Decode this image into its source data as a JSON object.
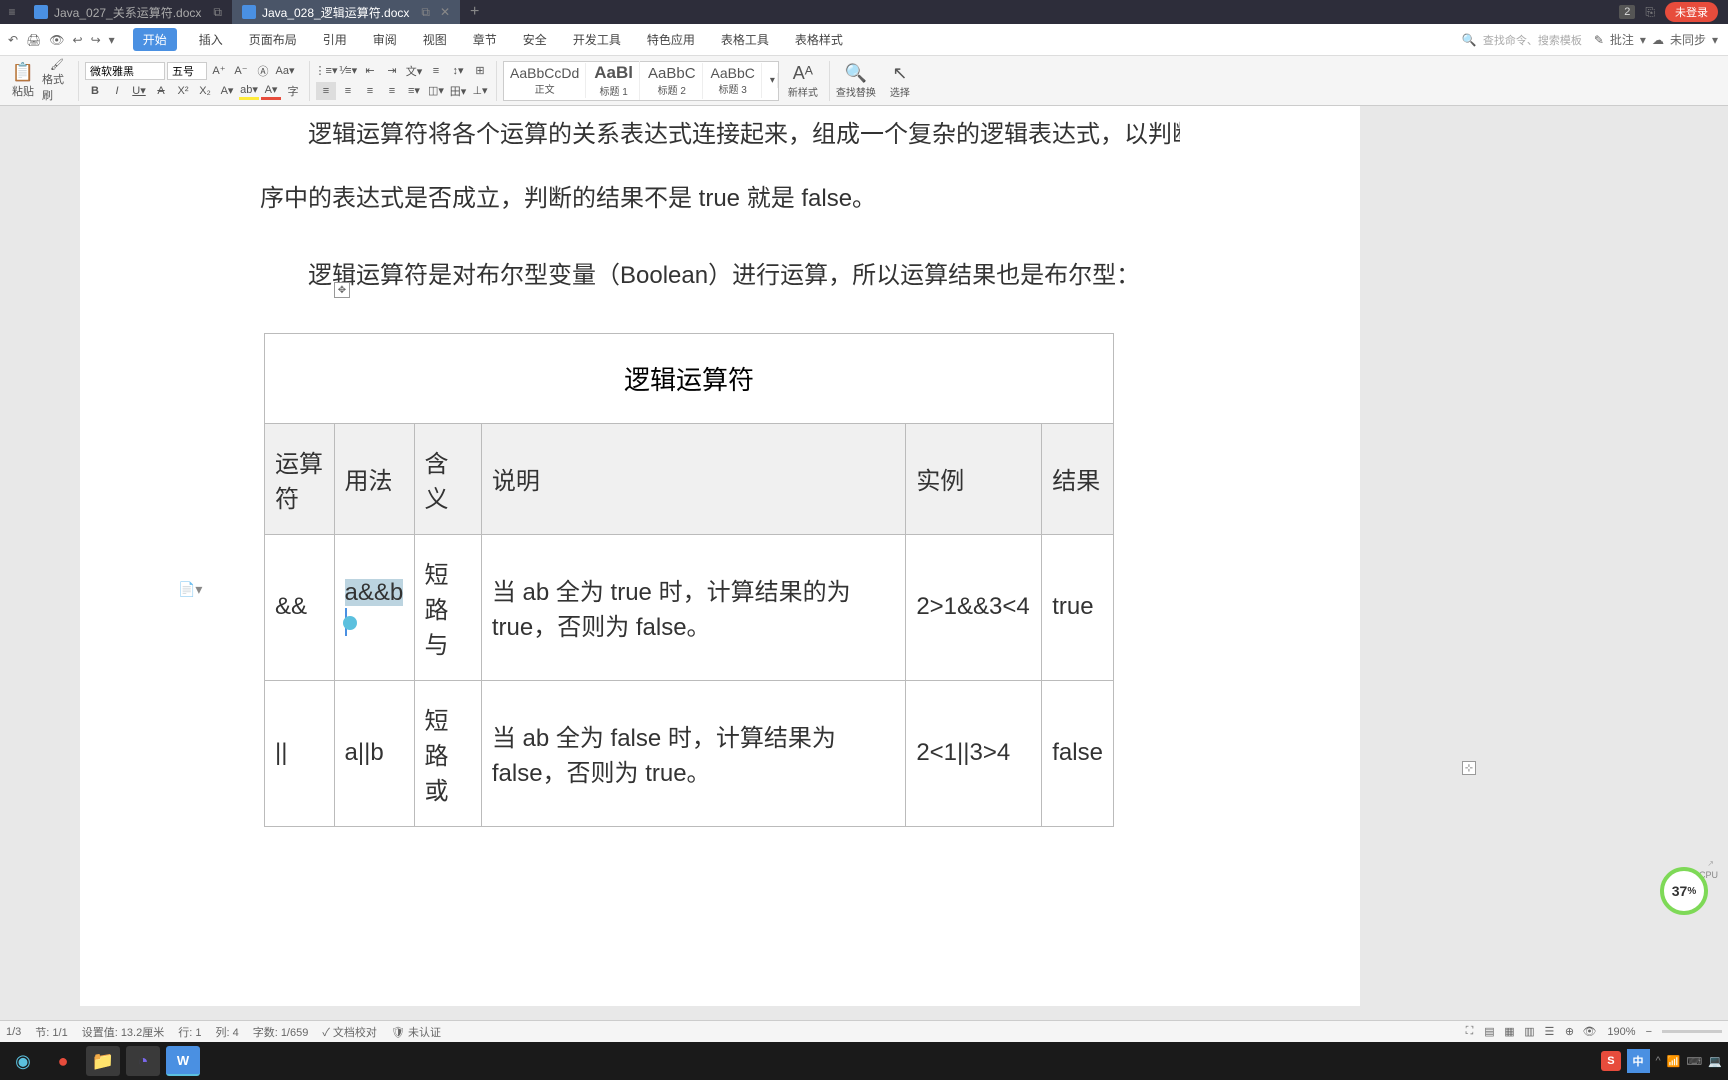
{
  "titlebar": {
    "tabs": [
      {
        "name": "Java_027_关系运算符.docx"
      },
      {
        "name": "Java_028_逻辑运算符.docx"
      }
    ],
    "notification_count": "2",
    "login_label": "未登录"
  },
  "menubar": {
    "items": [
      "开始",
      "插入",
      "页面布局",
      "引用",
      "审阅",
      "视图",
      "章节",
      "安全",
      "开发工具",
      "特色应用",
      "表格工具",
      "表格样式"
    ],
    "searchicon_label": "查找命令、搜索模板",
    "annotate_label": "批注",
    "sync_label": "未同步"
  },
  "ribbon": {
    "paste_label": "粘贴",
    "brush_label": "格式刷",
    "font_name": "微软雅黑",
    "font_size": "五号",
    "styles": [
      {
        "sample": "AaBbCcDd",
        "name": "正文"
      },
      {
        "sample": "AaBl",
        "name": "标题 1"
      },
      {
        "sample": "AaBbC",
        "name": "标题 2"
      },
      {
        "sample": "AaBbC",
        "name": "标题 3"
      }
    ],
    "newstyle_label": "新样式",
    "findreplace_label": "查找替换",
    "select_label": "选择"
  },
  "document": {
    "para1_partial": "逻辑运算符将各个运算的关系表达式连接起来，组成一个复杂的逻辑表达式，以判断程",
    "para1_cont": "序中的表达式是否成立，判断的结果不是 true 就是 false。",
    "para2": "逻辑运算符是对布尔型变量（Boolean）进行运算，所以运算结果也是布尔型：",
    "table": {
      "caption": "逻辑运算符",
      "headers": [
        "运算符",
        "用法",
        "含义",
        "说明",
        "实例",
        "结果"
      ],
      "rows": [
        {
          "op": "&&",
          "usage": "a&&b",
          "meaning": "短路与",
          "desc": "当 ab 全为 true 时，计算结果的为 true，否则为 false。",
          "example": "2>1&&3<4",
          "result": "true"
        },
        {
          "op": "||",
          "usage": "a||b",
          "meaning": "短路或",
          "desc": "当 ab 全为 false 时，计算结果为 false，否则为 true。",
          "example": "2<1||3>4",
          "result": "false"
        }
      ]
    }
  },
  "statusbar": {
    "page": "1/3",
    "section": "节: 1/1",
    "position": "设置值: 13.2厘米",
    "line": "行: 1",
    "col": "列: 4",
    "words": "字数: 1/659",
    "proof": "文档校对",
    "cert": "未认证",
    "zoom": "190%"
  },
  "cpu": {
    "value": "37",
    "unit": "%",
    "label": "CPU"
  },
  "ime": {
    "badge": "S",
    "lang": "中"
  }
}
